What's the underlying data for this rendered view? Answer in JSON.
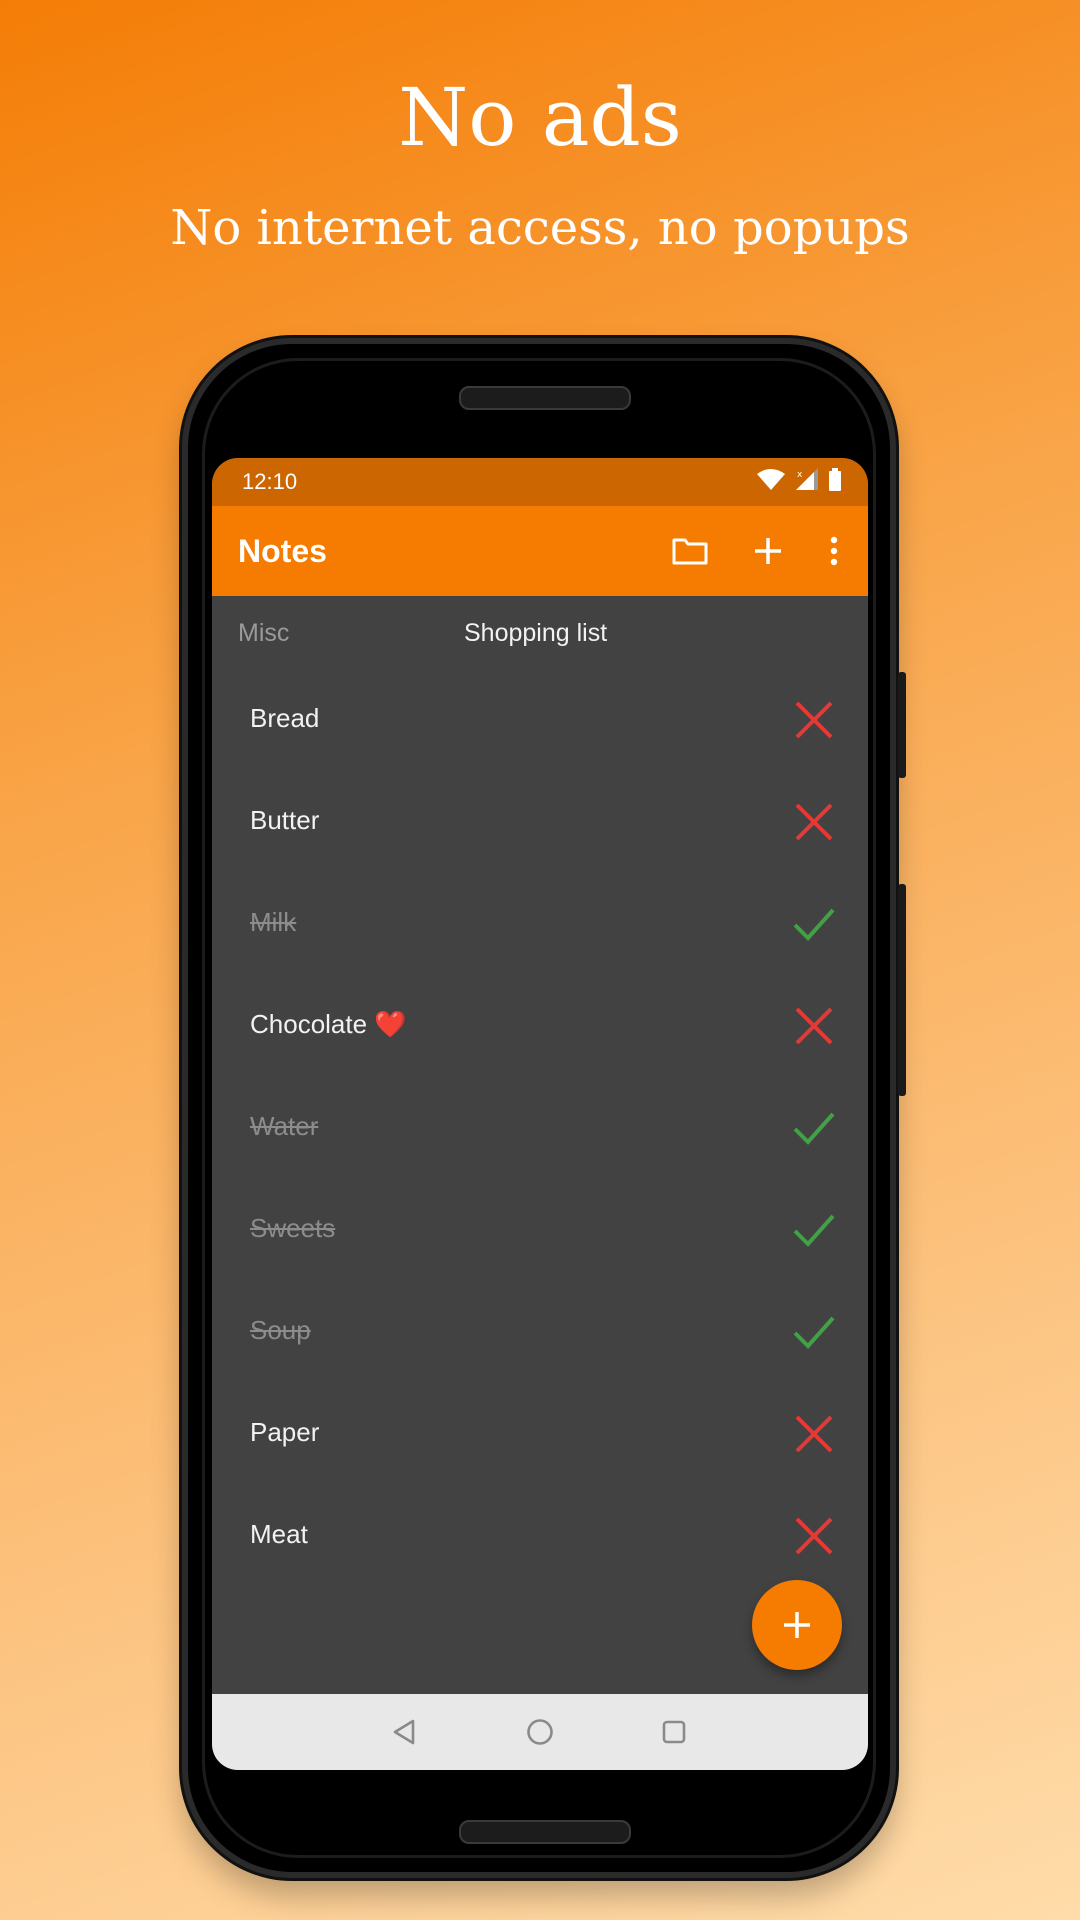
{
  "promo": {
    "title": "No ads",
    "subtitle": "No internet access, no popups"
  },
  "status_bar": {
    "time": "12:10",
    "icons": [
      "wifi-icon",
      "signal-icon",
      "battery-icon"
    ]
  },
  "app_bar": {
    "title": "Notes",
    "actions": [
      "folder-icon",
      "add-icon",
      "more-vert-icon"
    ],
    "color": "#f57c00"
  },
  "tabs": [
    {
      "label": "Misc",
      "selected": false
    },
    {
      "label": "Shopping list",
      "selected": true
    }
  ],
  "items": [
    {
      "label": "Bread",
      "done": false
    },
    {
      "label": "Butter",
      "done": false
    },
    {
      "label": "Milk",
      "done": true
    },
    {
      "label": "Chocolate ❤️",
      "done": false
    },
    {
      "label": "Water",
      "done": true
    },
    {
      "label": "Sweets",
      "done": true
    },
    {
      "label": "Soup",
      "done": true
    },
    {
      "label": "Paper",
      "done": false
    },
    {
      "label": "Meat",
      "done": false
    }
  ],
  "status_colors": {
    "done": "#43a047",
    "not_done": "#e53935"
  },
  "fab": {
    "icon": "add-icon"
  },
  "nav_bar": {
    "buttons": [
      "back-icon",
      "home-icon",
      "recents-icon"
    ]
  }
}
